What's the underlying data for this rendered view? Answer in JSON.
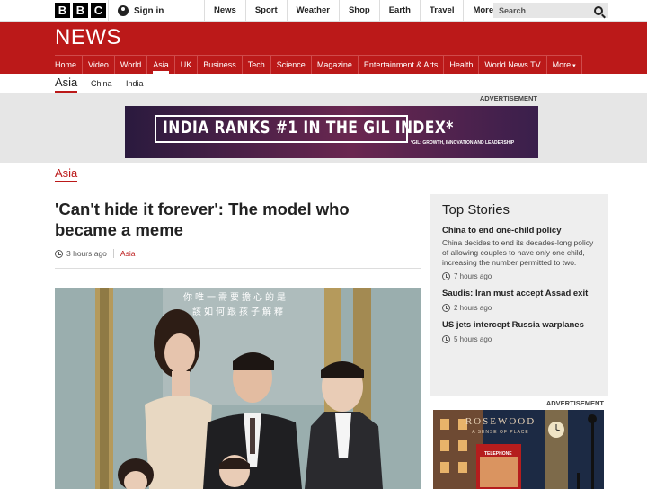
{
  "global": {
    "logo_letters": [
      "B",
      "B",
      "C"
    ],
    "signin_label": "Sign in",
    "nav": [
      "News",
      "Sport",
      "Weather",
      "Shop",
      "Earth",
      "Travel",
      "More"
    ],
    "search_placeholder": "Search"
  },
  "news": {
    "logo": "NEWS",
    "nav": [
      "Home",
      "Video",
      "World",
      "Asia",
      "UK",
      "Business",
      "Tech",
      "Science",
      "Magazine",
      "Entertainment & Arts",
      "Health",
      "World News TV",
      "More"
    ],
    "active": "Asia"
  },
  "subnav": {
    "primary": "Asia",
    "items": [
      "China",
      "India"
    ]
  },
  "advert": {
    "label": "ADVERTISEMENT",
    "headline": "INDIA RANKS #1 IN THE GIL INDEX*",
    "subtext": "*GIL: GROWTH, INNOVATION AND LEADERSHIP"
  },
  "article": {
    "section": "Asia",
    "headline": "'Can't hide it forever': The model who became a meme",
    "time": "3 hours ago",
    "section_link": "Asia",
    "photo_caption_overlay": [
      "你唯一需要擔心的是",
      "該如何跟孩子解釋"
    ]
  },
  "top_stories": {
    "title": "Top Stories",
    "stories": [
      {
        "title": "China to end one-child policy",
        "summary": "China decides to end its decades-long policy of allowing couples to have only one child, increasing the number permitted to two.",
        "time": "7 hours ago"
      },
      {
        "title": "Saudis: Iran must accept Assad exit",
        "summary": "",
        "time": "2 hours ago"
      },
      {
        "title": "US jets intercept Russia warplanes",
        "summary": "",
        "time": "5 hours ago"
      }
    ]
  },
  "side_advert": {
    "label": "ADVERTISEMENT",
    "brand": "ROSEWOOD",
    "tagline": "A SENSE OF PLACE",
    "sign": "TELEPHONE"
  },
  "colors": {
    "brand_red": "#bb1919",
    "panel_grey": "#eeeeee"
  }
}
